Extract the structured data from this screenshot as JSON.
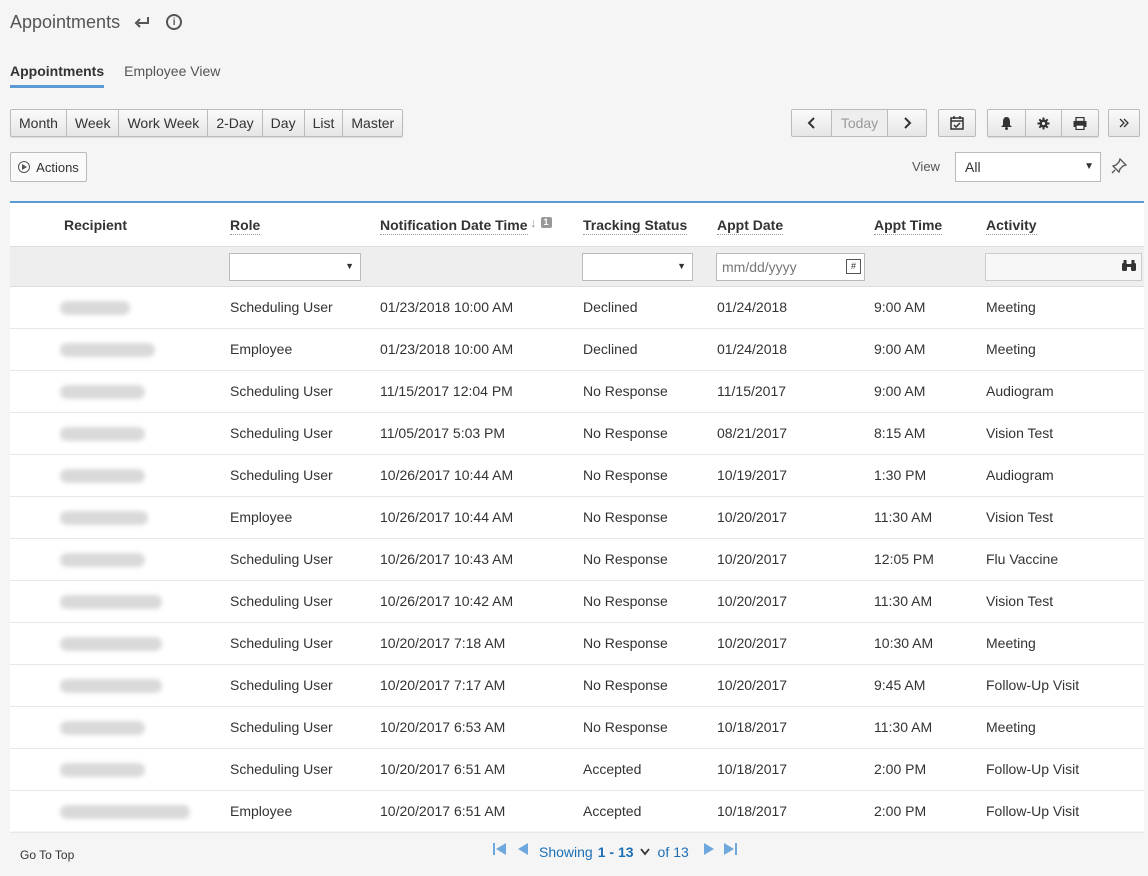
{
  "header": {
    "title": "Appointments"
  },
  "tabs": [
    {
      "label": "Appointments",
      "active": true
    },
    {
      "label": "Employee View",
      "active": false
    }
  ],
  "view_buttons": [
    "Month",
    "Week",
    "Work Week",
    "2-Day",
    "Day",
    "List",
    "Master"
  ],
  "nav": {
    "today": "Today"
  },
  "actions": {
    "label": "Actions"
  },
  "view_filter": {
    "label": "View",
    "value": "All"
  },
  "table": {
    "columns": {
      "recipient": "Recipient",
      "role": "Role",
      "notification": "Notification Date Time",
      "sort_index": "1",
      "tracking": "Tracking Status",
      "appt_date": "Appt Date",
      "appt_time": "Appt Time",
      "activity": "Activity"
    },
    "filters": {
      "date_placeholder": "mm/dd/yyyy"
    },
    "rows": [
      {
        "role": "Scheduling User",
        "notified": "01/23/2018 10:00 AM",
        "status": "Declined",
        "date": "01/24/2018",
        "time": "9:00 AM",
        "activity": "Meeting"
      },
      {
        "role": "Employee",
        "notified": "01/23/2018 10:00 AM",
        "status": "Declined",
        "date": "01/24/2018",
        "time": "9:00 AM",
        "activity": "Meeting"
      },
      {
        "role": "Scheduling User",
        "notified": "11/15/2017 12:04 PM",
        "status": "No Response",
        "date": "11/15/2017",
        "time": "9:00 AM",
        "activity": "Audiogram"
      },
      {
        "role": "Scheduling User",
        "notified": "11/05/2017 5:03 PM",
        "status": "No Response",
        "date": "08/21/2017",
        "time": "8:15 AM",
        "activity": "Vision Test"
      },
      {
        "role": "Scheduling User",
        "notified": "10/26/2017 10:44 AM",
        "status": "No Response",
        "date": "10/19/2017",
        "time": "1:30 PM",
        "activity": "Audiogram"
      },
      {
        "role": "Employee",
        "notified": "10/26/2017 10:44 AM",
        "status": "No Response",
        "date": "10/20/2017",
        "time": "11:30 AM",
        "activity": "Vision Test"
      },
      {
        "role": "Scheduling User",
        "notified": "10/26/2017 10:43 AM",
        "status": "No Response",
        "date": "10/20/2017",
        "time": "12:05 PM",
        "activity": "Flu Vaccine"
      },
      {
        "role": "Scheduling User",
        "notified": "10/26/2017 10:42 AM",
        "status": "No Response",
        "date": "10/20/2017",
        "time": "11:30 AM",
        "activity": "Vision Test"
      },
      {
        "role": "Scheduling User",
        "notified": "10/20/2017 7:18 AM",
        "status": "No Response",
        "date": "10/20/2017",
        "time": "10:30 AM",
        "activity": "Meeting"
      },
      {
        "role": "Scheduling User",
        "notified": "10/20/2017 7:17 AM",
        "status": "No Response",
        "date": "10/20/2017",
        "time": "9:45 AM",
        "activity": "Follow-Up Visit"
      },
      {
        "role": "Scheduling User",
        "notified": "10/20/2017 6:53 AM",
        "status": "No Response",
        "date": "10/18/2017",
        "time": "11:30 AM",
        "activity": "Meeting"
      },
      {
        "role": "Scheduling User",
        "notified": "10/20/2017 6:51 AM",
        "status": "Accepted",
        "date": "10/18/2017",
        "time": "2:00 PM",
        "activity": "Follow-Up Visit"
      },
      {
        "role": "Employee",
        "notified": "10/20/2017 6:51 AM",
        "status": "Accepted",
        "date": "10/18/2017",
        "time": "2:00 PM",
        "activity": "Follow-Up Visit"
      }
    ]
  },
  "footer": {
    "go_top": "Go To Top",
    "showing": "Showing",
    "range_start": "1",
    "range_sep": " - ",
    "range_end": "13",
    "of": "of",
    "total": "13"
  },
  "icons": [
    "return-icon",
    "info-icon",
    "chevron-left-icon",
    "chevron-right-icon",
    "calendar-check-icon",
    "bell-icon",
    "gear-icon",
    "print-icon",
    "double-chevron-right-icon",
    "pin-icon",
    "calendar-icon",
    "binoculars-icon",
    "first-page-icon",
    "prev-page-icon",
    "next-page-icon",
    "last-page-icon"
  ],
  "colors": {
    "accent": "#5b9bd5",
    "link": "#1d6fb5"
  }
}
